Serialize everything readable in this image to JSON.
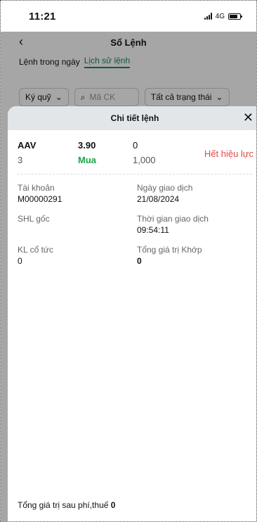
{
  "status_bar": {
    "time": "11:21",
    "network": "4G"
  },
  "header": {
    "back_icon": "‹",
    "title": "Sổ Lệnh"
  },
  "tabs": [
    {
      "label": "Lệnh trong ngày"
    },
    {
      "label": "Lịch sử lệnh"
    }
  ],
  "filters": {
    "account_type": "Ký quỹ",
    "code_placeholder": "Mã CK",
    "status": "Tất cả trạng thái"
  },
  "sheet": {
    "title": "Chi tiết lệnh",
    "close_icon": "✕",
    "symbol": "AAV",
    "price": "3.90",
    "matched": "0",
    "qty": "3",
    "side": "Mua",
    "volume": "1,000",
    "status": "Hết hiệu lực",
    "fields": [
      {
        "label": "Tài khoản",
        "value": "M00000291"
      },
      {
        "label": "Ngày giao dịch",
        "value": "21/08/2024"
      },
      {
        "label": "SHL gốc",
        "value": ""
      },
      {
        "label": "Thời gian giao dịch",
        "value": "09:54:11"
      },
      {
        "label": "KL cổ tức",
        "value": "0"
      },
      {
        "label": "Tổng giá trị Khớp",
        "value": "0"
      }
    ],
    "footer": {
      "label": "Tổng giá trị sau phí,thuế",
      "value": "0"
    }
  },
  "colors": {
    "green": "#1aa64a",
    "red": "#e04a4a",
    "sheet_header": "#e2e6e9"
  }
}
